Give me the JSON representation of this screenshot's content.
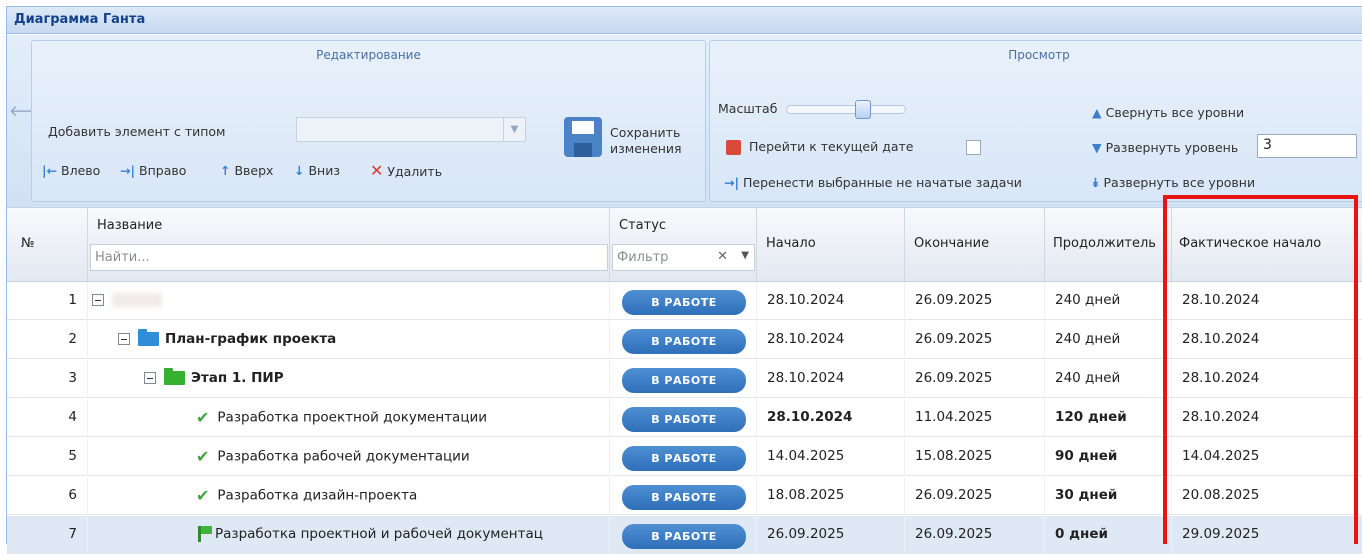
{
  "window": {
    "title": "Диаграмма Ганта"
  },
  "ribbon": {
    "editing": {
      "title": "Редактирование",
      "add_label": "Добавить элемент с типом",
      "save_label_1": "Сохранить",
      "save_label_2": "изменения",
      "left": "Влево",
      "right": "Вправо",
      "up": "Вверх",
      "down": "Вниз",
      "delete": "Удалить"
    },
    "view": {
      "title": "Просмотр",
      "scale_label": "Масштаб",
      "goto_today": "Перейти к текущей дате",
      "move_tasks": "Перенести выбранные не начатые задачи",
      "collapse_all": "Свернуть все уровни",
      "expand_level": "Развернуть уровень",
      "expand_level_value": "3",
      "expand_all": "Развернуть все уровни"
    }
  },
  "grid": {
    "columns": {
      "num": "№",
      "name": "Название",
      "name_placeholder": "Найти...",
      "status": "Статус",
      "status_placeholder": "Фильтр",
      "start": "Начало",
      "end": "Окончание",
      "duration": "Продолжитель",
      "actual_start": "Фактическое начало"
    },
    "rows": [
      {
        "num": "1",
        "name": "",
        "status": "В РАБОТЕ",
        "start": "28.10.2024",
        "end": "26.09.2025",
        "duration": "240 дней",
        "actual_start": "28.10.2024"
      },
      {
        "num": "2",
        "name": "План-график проекта",
        "status": "В РАБОТЕ",
        "start": "28.10.2024",
        "end": "26.09.2025",
        "duration": "240 дней",
        "actual_start": "28.10.2024"
      },
      {
        "num": "3",
        "name": "Этап 1. ПИР",
        "status": "В РАБОТЕ",
        "start": "28.10.2024",
        "end": "26.09.2025",
        "duration": "240 дней",
        "actual_start": "28.10.2024"
      },
      {
        "num": "4",
        "name": "Разработка проектной документации",
        "status": "В РАБОТЕ",
        "start": "28.10.2024",
        "end": "11.04.2025",
        "duration": "120 дней",
        "actual_start": "28.10.2024"
      },
      {
        "num": "5",
        "name": "Разработка рабочей документации",
        "status": "В РАБОТЕ",
        "start": "14.04.2025",
        "end": "15.08.2025",
        "duration": "90 дней",
        "actual_start": "14.04.2025"
      },
      {
        "num": "6",
        "name": "Разработка дизайн-проекта",
        "status": "В РАБОТЕ",
        "start": "18.08.2025",
        "end": "26.09.2025",
        "duration": "30 дней",
        "actual_start": "20.08.2025"
      },
      {
        "num": "7",
        "name": "Разработка проектной и рабочей документац",
        "status": "В РАБОТЕ",
        "start": "26.09.2025",
        "end": "26.09.2025",
        "duration": "0 дней",
        "actual_start": "29.09.2025"
      }
    ]
  },
  "colors": {
    "accent": "#2f6fb9",
    "highlight": "#e81414",
    "title_text": "#15428b"
  }
}
